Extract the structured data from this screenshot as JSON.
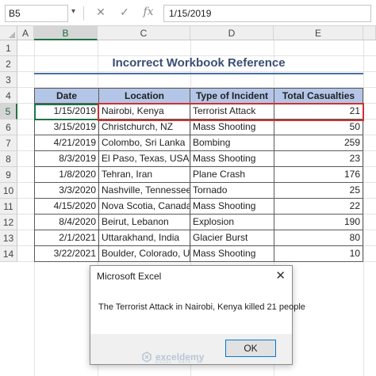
{
  "formula_bar": {
    "name_box": "B5",
    "cancel_icon": "cancel-x-icon",
    "enter_icon": "enter-check-icon",
    "function_icon": "insert-function-icon",
    "fx_label": "fx",
    "formula": "1/15/2019"
  },
  "grid": {
    "columns": [
      "A",
      "B",
      "C",
      "D",
      "E"
    ],
    "rows": [
      "1",
      "2",
      "3",
      "4",
      "5",
      "6",
      "7",
      "8",
      "9",
      "10",
      "11",
      "12",
      "13",
      "14"
    ],
    "selected_column": "B",
    "selected_row": "5"
  },
  "sheet": {
    "title": "Incorrect Workbook Reference"
  },
  "table": {
    "headers": [
      "Date",
      "Location",
      "Type of Incident",
      "Total Casualties"
    ],
    "rows": [
      [
        "1/15/2019",
        "Nairobi, Kenya",
        "Terrorist Attack",
        "21"
      ],
      [
        "3/15/2019",
        "Christchurch, NZ",
        "Mass Shooting",
        "50"
      ],
      [
        "4/21/2019",
        "Colombo, Sri Lanka",
        "Bombing",
        "259"
      ],
      [
        "8/3/2019",
        "El Paso, Texas, USA",
        "Mass Shooting",
        "23"
      ],
      [
        "1/8/2020",
        "Tehran, Iran",
        "Plane Crash",
        "176"
      ],
      [
        "3/3/2020",
        "Nashville, Tennessee",
        "Tornado",
        "25"
      ],
      [
        "4/15/2020",
        "Nova Scotia, Canada",
        "Mass Shooting",
        "22"
      ],
      [
        "8/4/2020",
        "Beirut, Lebanon",
        "Explosion",
        "190"
      ],
      [
        "2/1/2021",
        "Uttarakhand, India",
        "Glacier Burst",
        "80"
      ],
      [
        "3/22/2021",
        "Boulder, Colorado, USA",
        "Mass Shooting",
        "10"
      ]
    ]
  },
  "dialog": {
    "title": "Microsoft Excel",
    "close_icon": "close-icon",
    "message": "The Terrorist Attack in Nairobi, Kenya killed 21 people",
    "ok_label": "OK"
  },
  "watermark": {
    "brand": "exceldemy",
    "tagline": "EXCEL · DATA · BI"
  },
  "colors": {
    "header_fill": "#b4c6e7",
    "title_text": "#3a4f73",
    "selection": "#217346",
    "highlight": "#d22f2f"
  }
}
